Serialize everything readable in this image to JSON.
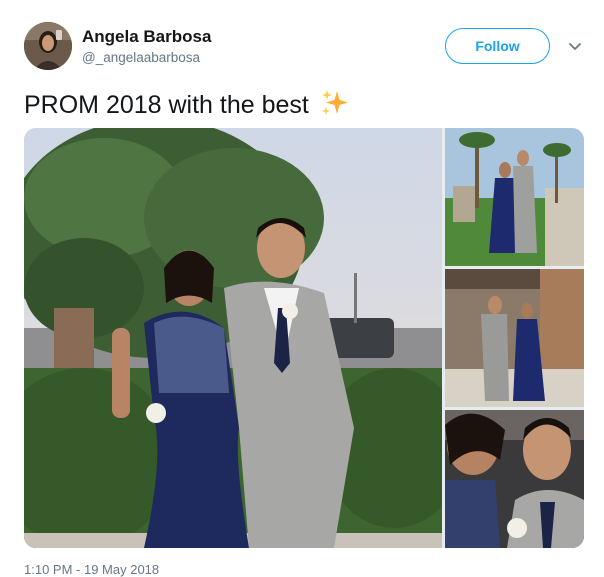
{
  "author": {
    "display_name": "Angela Barbosa",
    "handle": "@_angelaabarbosa",
    "avatar_icon": "profile-photo"
  },
  "actions": {
    "follow_label": "Follow",
    "menu_icon": "chevron-down-icon"
  },
  "tweet": {
    "text": "PROM 2018 with the best",
    "emoji": "sparkles-icon"
  },
  "media": {
    "photo_count": 4
  },
  "meta": {
    "timestamp": "1:10 PM - 19 May 2018"
  },
  "colors": {
    "accent": "#1da1f2",
    "secondary_text": "#657786",
    "primary_text": "#14171a",
    "sparkle": "#ffac33"
  }
}
